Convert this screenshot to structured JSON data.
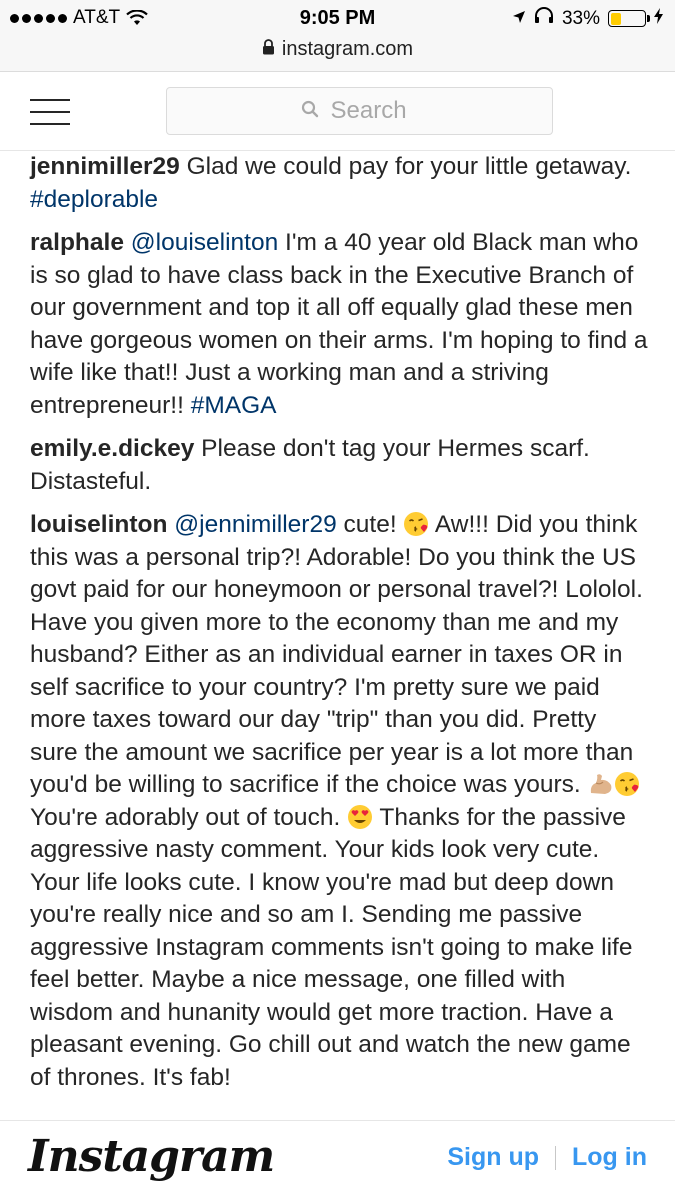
{
  "status_bar": {
    "carrier": "AT&T",
    "time": "9:05 PM",
    "battery_percent": "33%",
    "battery_level": 0.33,
    "battery_color": "#ffcc00"
  },
  "browser": {
    "url": "instagram.com"
  },
  "header": {
    "search_placeholder": "Search"
  },
  "comments": [
    {
      "username": "jennimiller29",
      "text": " Glad we could pay for your little getaway. ",
      "hashtag": "#deplorable"
    },
    {
      "username": "ralphale",
      "mention": "@louiselinton",
      "text": " I'm a 40 year old Black man who is so glad to have class back in the Executive Branch of our government and top it all off equally glad these men have gorgeous women on their arms. I'm hoping to find a wife like that!! Just a working man and a striving entrepreneur!! ",
      "hashtag": "#MAGA"
    },
    {
      "username": "emily.e.dickey",
      "text": " Please don't tag your Hermes scarf. Distasteful."
    },
    {
      "username": "louiselinton",
      "mention": "@jennimiller29",
      "text_1": " cute! ",
      "emoji_1": "kiss-emoji",
      "text_2": " Aw!!! Did you think this was a personal trip?! Adorable! Do you think the US govt paid for our honeymoon or personal travel?! Lololol. Have you given more to the economy than me and my husband? Either as an individual earner in taxes OR in self sacrifice to your country? I'm pretty sure we paid more taxes toward our day \"trip\" than you did. Pretty sure the amount we sacrifice per year is a lot more than you'd be willing to sacrifice if the choice was yours. ",
      "emoji_2": "flexed-biceps-emoji",
      "emoji_3": "kiss-emoji",
      "text_3": " You're adorably out of touch. ",
      "emoji_4": "heart-eyes-emoji",
      "text_4": " Thanks for the passive aggressive nasty comment. Your kids look very cute. Your life looks cute. I know you're mad but deep down you're really nice and so am I. Sending me passive aggressive Instagram comments isn't going to make life feel better. Maybe a nice message, one filled with wisdom and hunanity would get more traction. Have a pleasant evening. Go chill out and watch the new game of thrones. It's fab!"
    }
  ],
  "footer": {
    "logo": "Instagram",
    "sign_up": "Sign up",
    "log_in": "Log in",
    "link_color": "#3897f0"
  }
}
